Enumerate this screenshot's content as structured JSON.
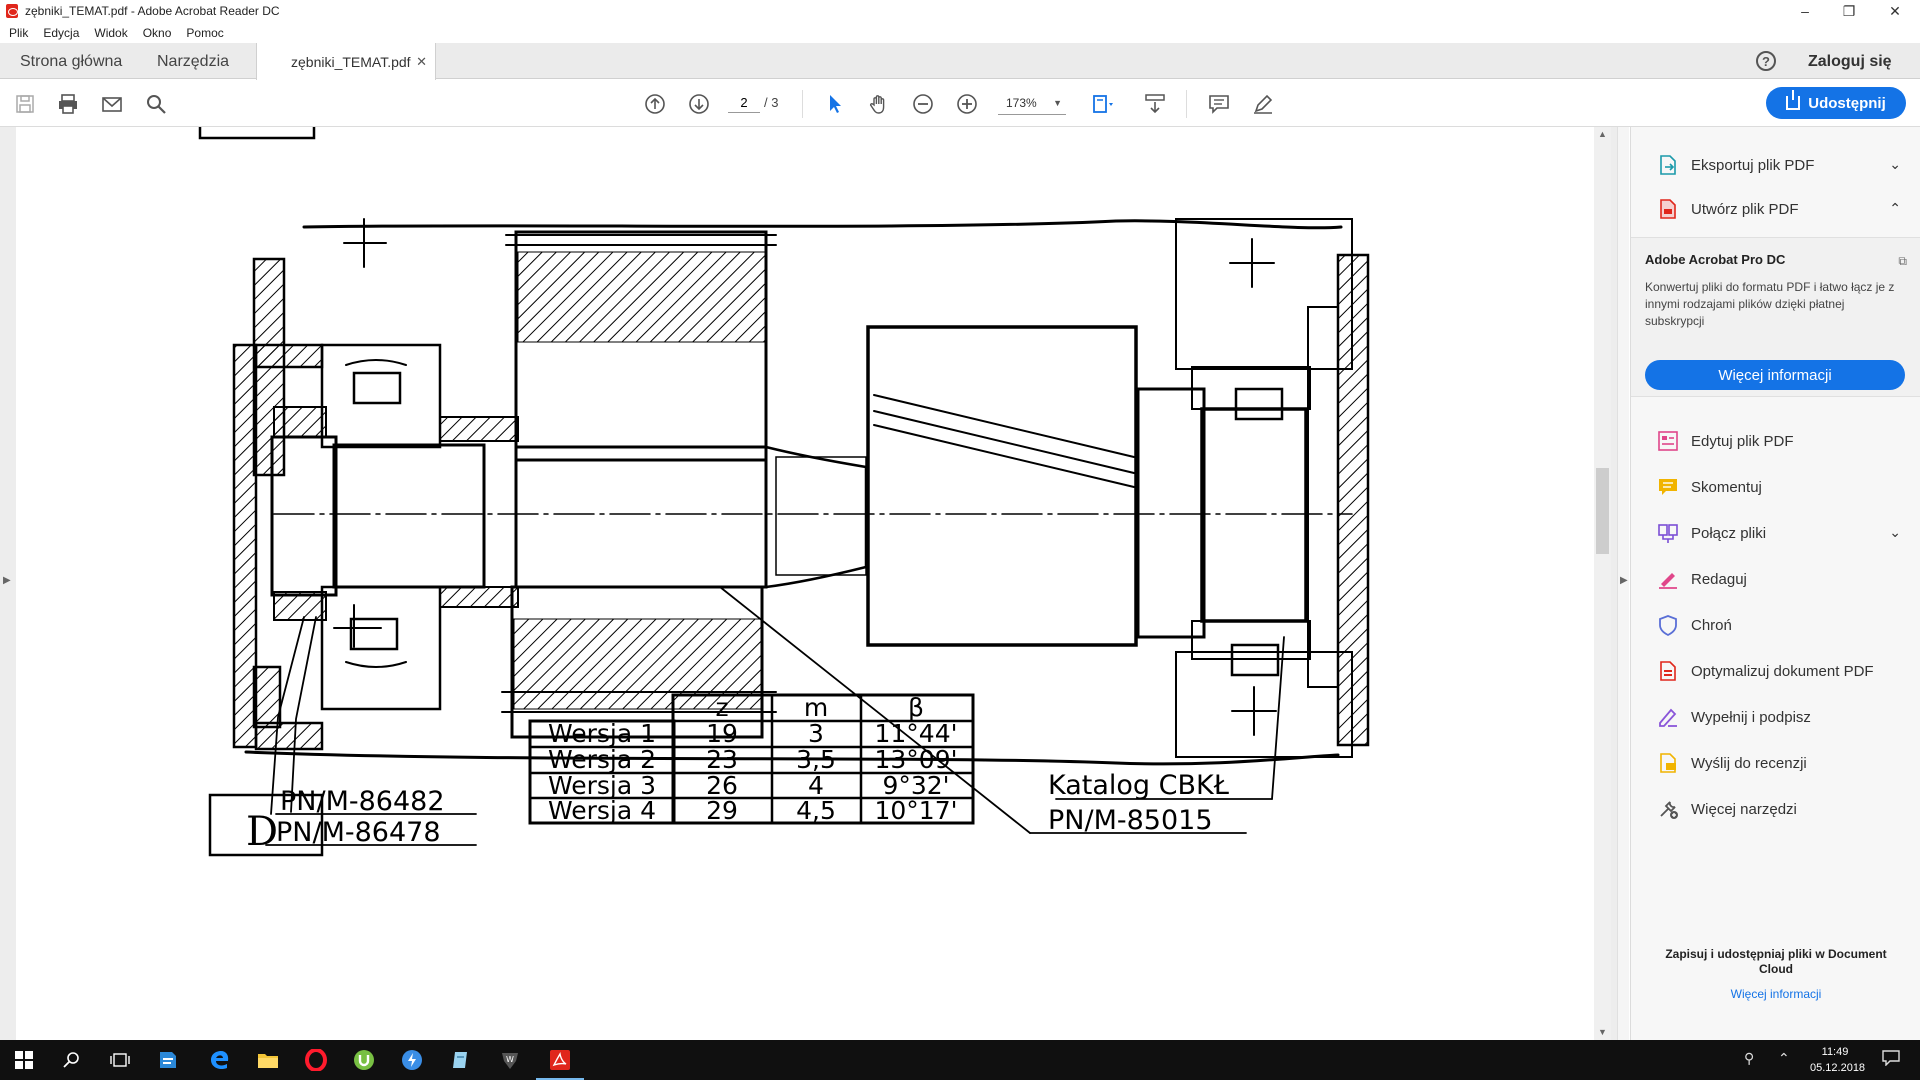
{
  "window": {
    "title": "zębniki_TEMAT.pdf - Adobe Acrobat Reader DC",
    "minimize": "–",
    "restore": "❐",
    "close": "✕"
  },
  "menu": [
    "Plik",
    "Edycja",
    "Widok",
    "Okno",
    "Pomoc"
  ],
  "tabs": {
    "home": "Strona główna",
    "tools": "Narzędzia",
    "document": "zębniki_TEMAT.pdf",
    "close": "✕",
    "help": "?",
    "login": "Zaloguj się"
  },
  "toolbar": {
    "page_current": "2",
    "page_total": "/ 3",
    "zoom": "173%",
    "share": "Udostępnij"
  },
  "drawing": {
    "standards": [
      "PN/M-86482",
      "PN/M-86478",
      "Katalog CBKŁ",
      "PN/M-85015"
    ],
    "section_letter": "D",
    "table": {
      "headers": [
        "z",
        "m",
        "β"
      ],
      "rows": [
        {
          "version": "Wersja 1",
          "z": "19",
          "m": "3",
          "beta": "11°44'"
        },
        {
          "version": "Wersja 2",
          "z": "23",
          "m": "3,5",
          "beta": "13°09'"
        },
        {
          "version": "Wersja 3",
          "z": "26",
          "m": "4",
          "beta": "9°32'"
        },
        {
          "version": "Wersja 4",
          "z": "29",
          "m": "4,5",
          "beta": "10°17'"
        }
      ]
    }
  },
  "right_panel": {
    "export": "Eksportuj plik PDF",
    "create": "Utwórz plik PDF",
    "promo_title": "Adobe Acrobat Pro DC",
    "promo_desc": "Konwertuj pliki do formatu PDF i łatwo łącz je z innymi rodzajami plików dzięki płatnej subskrypcji",
    "promo_button": "Więcej informacji",
    "tools": [
      {
        "label": "Edytuj plik PDF",
        "icon": "edit-pdf-icon",
        "color": "#e0468a"
      },
      {
        "label": "Skomentuj",
        "icon": "comment-icon",
        "color": "#f1b400"
      },
      {
        "label": "Połącz pliki",
        "icon": "combine-icon",
        "color": "#7b4fd6"
      },
      {
        "label": "Redaguj",
        "icon": "redact-icon",
        "color": "#e0468a"
      },
      {
        "label": "Chroń",
        "icon": "protect-icon",
        "color": "#5a6fd6"
      },
      {
        "label": "Optymalizuj dokument PDF",
        "icon": "optimize-icon",
        "color": "#e0261b"
      },
      {
        "label": "Wypełnij i podpisz",
        "icon": "fill-sign-icon",
        "color": "#8a56d9"
      },
      {
        "label": "Wyślij do recenzji",
        "icon": "send-review-icon",
        "color": "#f1b400"
      },
      {
        "label": "Więcej narzędzi",
        "icon": "more-tools-icon",
        "color": "#555555"
      }
    ],
    "cloud_title": "Zapisuj i udostępniaj pliki w Document Cloud",
    "cloud_link": "Więcej informacji"
  },
  "taskbar": {
    "time": "11:49",
    "date": "05.12.2018"
  },
  "colors": {
    "accent": "#1473e6",
    "taskbar": "#101010"
  }
}
